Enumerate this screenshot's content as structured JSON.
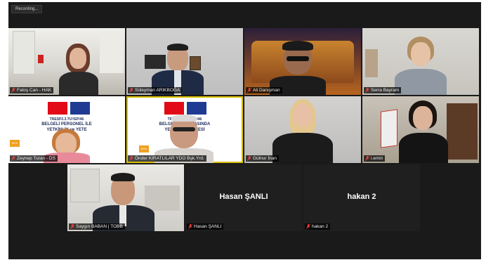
{
  "recording": "Recording...",
  "participants": [
    {
      "name": "Fatoş Can - HAK"
    },
    {
      "name": "Süleyman ARIKBOĞA"
    },
    {
      "name": "Ali Danışman"
    },
    {
      "name": "Serra Bayram"
    },
    {
      "name": "Zeynep Turan - DS"
    },
    {
      "name": "Önder KIRATLILAR YDO Bşk.Yrd."
    },
    {
      "name": "Gülnur İnan"
    },
    {
      "name": "i.emin"
    },
    {
      "name": "Saygın BABAN | TOBB"
    },
    {
      "name": "Hasan ŞANLI"
    },
    {
      "name": "hakan 2"
    }
  ],
  "banner": {
    "line1": "TRESP2.3.TUYEP/46",
    "line2": "BELGELİ PERSONEL İLE",
    "line3": "YETKİNLİK ve YETE",
    "line2b": "BELGELİ P    DÜNYASINDA",
    "line3b": "YETKİN        İK PROJESİ",
    "tag1": "MYK",
    "tag2": "TRE"
  },
  "colors": {
    "mic_muted": "#e0403a",
    "active_speaker": "#d9c000"
  }
}
